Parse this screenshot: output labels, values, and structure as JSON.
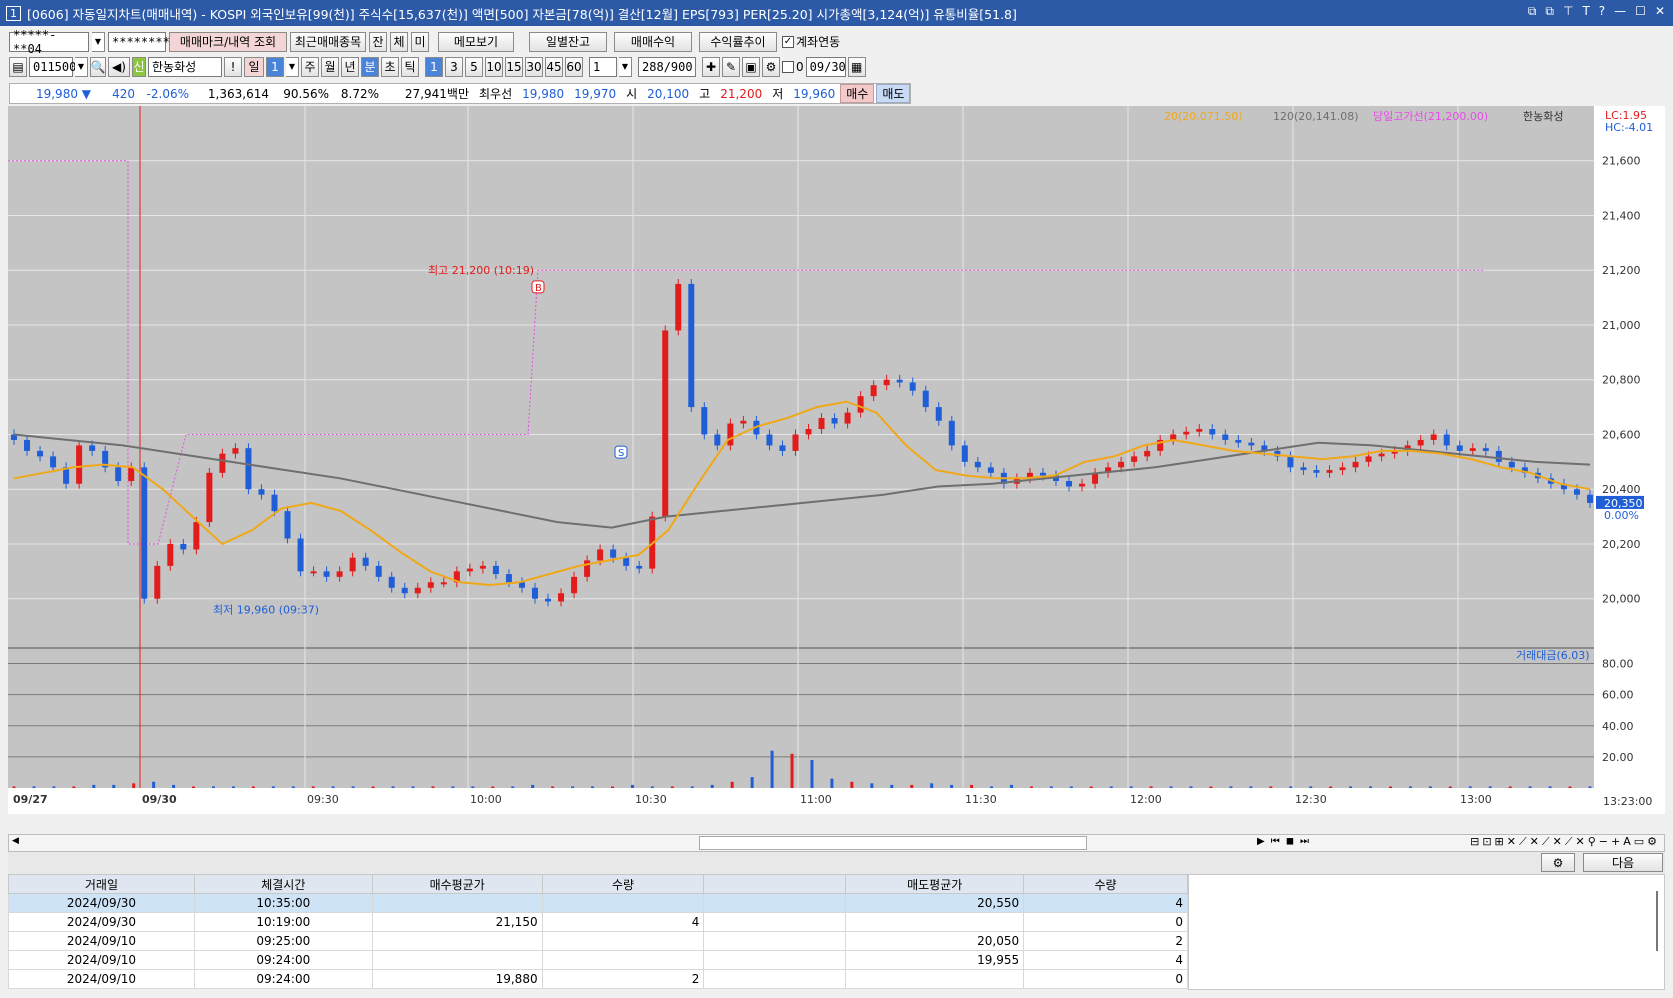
{
  "title": {
    "window_num": "1",
    "text": "[0606] 자동일지차트(매매내역) - KOSPI 외국인보유[99(천)] 주식수[15,637(천)] 액면[500] 자본금[78(억)] 결산[12월] EPS[793] PER[25.20] 시가총액[3,124(억)] 유통비율[51.8]",
    "controls": [
      "⧉",
      "⧉",
      "⊤",
      "T",
      "?",
      "—",
      "☐",
      "✕"
    ]
  },
  "toolbar1": {
    "account": "*****-**04",
    "password": "********",
    "btn_trade_mark": "매매마크/내역 조회",
    "btn_recent": "최근매매종목",
    "btn_jan": "잔",
    "btn_che": "체",
    "btn_mi": "미",
    "btn_memo": "메모보기",
    "btn_daily": "일별잔고",
    "btn_profit": "매매수익",
    "btn_trend": "수익률추이",
    "chk_account_link": "계좌연동"
  },
  "toolbar2": {
    "code": "011500",
    "badge": "신",
    "name": "한농화성",
    "excl": "!",
    "periods": [
      "일",
      "1",
      "주",
      "월",
      "년",
      "분",
      "초",
      "틱"
    ],
    "intervals": [
      "1",
      "3",
      "5",
      "10",
      "15",
      "30",
      "45",
      "60"
    ],
    "count_value": "1",
    "view_count": "288",
    "view_total": "/900",
    "zero": "0",
    "date": "09/30"
  },
  "quote": {
    "price": "19,980 ▼",
    "change": "420",
    "rate": "-2.06%",
    "volume": "1,363,614",
    "vol_ratio": "90.56%",
    "turnover": "8.72%",
    "amount": "27,941백만",
    "best_label": "최우선",
    "best_ask": "19,980",
    "best_bid": "19,970",
    "open_label": "시",
    "open": "20,100",
    "high_label": "고",
    "high": "21,200",
    "low_label": "저",
    "low": "19,960",
    "buy_btn": "매수",
    "sell_btn": "매도"
  },
  "chart_legend": {
    "ma20": "20(20,071.50)",
    "ma120": "120(20,141.08)",
    "dayhigh": "당일고가선(21,200.00)",
    "name": "한농화성",
    "lc": "LC:1.95",
    "hc": "HC:-4.01",
    "volume_label": "거래대금(6.03)"
  },
  "chart_annotations": {
    "high_text": "최고 21,200 (10:19)",
    "low_text": "최저 19,960 (09:37)",
    "buy_marker": "B",
    "sell_marker": "S",
    "current_price": "20,350",
    "current_pct": "0.00%",
    "last_time": "13:23:00"
  },
  "chart_data": {
    "type": "candlestick",
    "x": [
      "09/27",
      "09/30",
      "09:30",
      "10:00",
      "10:30",
      "11:00",
      "11:30",
      "12:00",
      "12:30",
      "13:00"
    ],
    "price_axis": [
      20000,
      20200,
      20400,
      20600,
      20800,
      21000,
      21200,
      21400,
      21600
    ],
    "price_tick_labels": [
      "20,000",
      "20,200",
      "20,400",
      "20,600",
      "20,800",
      "21,000",
      "21,200",
      "21,400",
      "21,600"
    ],
    "ylim": [
      19820,
      21800
    ],
    "volume_axis": [
      20,
      40,
      60,
      80
    ],
    "volume_tick_labels": [
      "20.00",
      "40.00",
      "60.00",
      "80.00"
    ],
    "close_points": [
      20580,
      20540,
      20520,
      20480,
      20420,
      20560,
      20540,
      20480,
      20430,
      20480,
      20000,
      20120,
      20200,
      20180,
      20280,
      20460,
      20530,
      20550,
      20400,
      20380,
      20320,
      20220,
      20100,
      20100,
      20080,
      20100,
      20150,
      20120,
      20080,
      20040,
      20020,
      20040,
      20060,
      20060,
      20100,
      20110,
      20120,
      20090,
      20060,
      20040,
      20000,
      19990,
      20020,
      20080,
      20140,
      20180,
      20150,
      20120,
      20110,
      20300,
      20980,
      21150,
      20700,
      20600,
      20560,
      20640,
      20650,
      20600,
      20560,
      20540,
      20600,
      20620,
      20660,
      20640,
      20680,
      20740,
      20780,
      20800,
      20790,
      20760,
      20700,
      20650,
      20560,
      20500,
      20480,
      20460,
      20420,
      20440,
      20460,
      20450,
      20430,
      20410,
      20420,
      20460,
      20480,
      20500,
      20520,
      20540,
      20580,
      20600,
      20610,
      20620,
      20600,
      20580,
      20570,
      20560,
      20540,
      20520,
      20480,
      20470,
      20460,
      20470,
      20480,
      20500,
      20520,
      20530,
      20540,
      20560,
      20580,
      20600,
      20560,
      20540,
      20550,
      20540,
      20500,
      20480,
      20460,
      20440,
      20420,
      20400,
      20380,
      20350
    ],
    "ma20_points": [
      20440,
      20460,
      20480,
      20490,
      20480,
      20400,
      20300,
      20200,
      20250,
      20330,
      20350,
      20320,
      20250,
      20170,
      20100,
      20060,
      20050,
      20060,
      20090,
      20120,
      20140,
      20160,
      20250,
      20420,
      20580,
      20630,
      20660,
      20700,
      20720,
      20680,
      20560,
      20470,
      20450,
      20440,
      20440,
      20450,
      20500,
      20520,
      20560,
      20580,
      20560,
      20540,
      20530,
      20520,
      20510,
      20520,
      20540,
      20540,
      20530,
      20510,
      20480,
      20460,
      20420,
      20400
    ],
    "ma120_points": [
      20600,
      20580,
      20560,
      20530,
      20500,
      20470,
      20440,
      20400,
      20360,
      20320,
      20280,
      20260,
      20300,
      20320,
      20340,
      20360,
      20380,
      20410,
      20420,
      20440,
      20460,
      20480,
      20510,
      20540,
      20570,
      20560,
      20540,
      20520,
      20500,
      20490
    ],
    "volume_points": [
      1,
      1,
      1,
      1,
      2,
      2,
      3,
      4,
      2,
      1,
      1,
      1,
      1,
      1,
      1,
      1,
      1,
      1,
      1,
      1,
      1,
      1,
      1,
      1,
      1,
      1,
      2,
      1,
      1,
      1,
      1,
      2,
      1,
      1,
      1,
      2,
      4,
      7,
      24,
      22,
      18,
      6,
      4,
      3,
      2,
      2,
      3,
      2,
      2,
      1,
      2,
      1,
      1,
      1,
      1,
      1,
      1,
      1,
      1,
      1,
      1,
      1,
      1,
      1,
      1,
      1,
      1,
      1,
      1,
      1,
      1,
      1,
      1,
      1,
      1,
      1,
      1,
      1,
      1,
      1
    ]
  },
  "table": {
    "headers": [
      "거래일",
      "체결시간",
      "매수평균가",
      "수량",
      "",
      "매도평균가",
      "수량"
    ],
    "rows": [
      [
        "2024/09/30",
        "10:35:00",
        "",
        "",
        "",
        "20,550",
        "4"
      ],
      [
        "2024/09/30",
        "10:19:00",
        "21,150",
        "4",
        "",
        "",
        "0"
      ],
      [
        "2024/09/10",
        "09:25:00",
        "",
        "",
        "",
        "20,050",
        "2"
      ],
      [
        "2024/09/10",
        "09:24:00",
        "",
        "",
        "",
        "19,955",
        "4"
      ],
      [
        "2024/09/10",
        "09:24:00",
        "19,880",
        "2",
        "",
        "",
        "0"
      ]
    ]
  },
  "bottom": {
    "next_btn": "다음"
  },
  "colors": {
    "up": "#e21b1b",
    "down": "#1f5ed6",
    "ma20": "#f0a818",
    "ma120": "#6f6f6f",
    "dayhigh": "#e64ce6"
  }
}
